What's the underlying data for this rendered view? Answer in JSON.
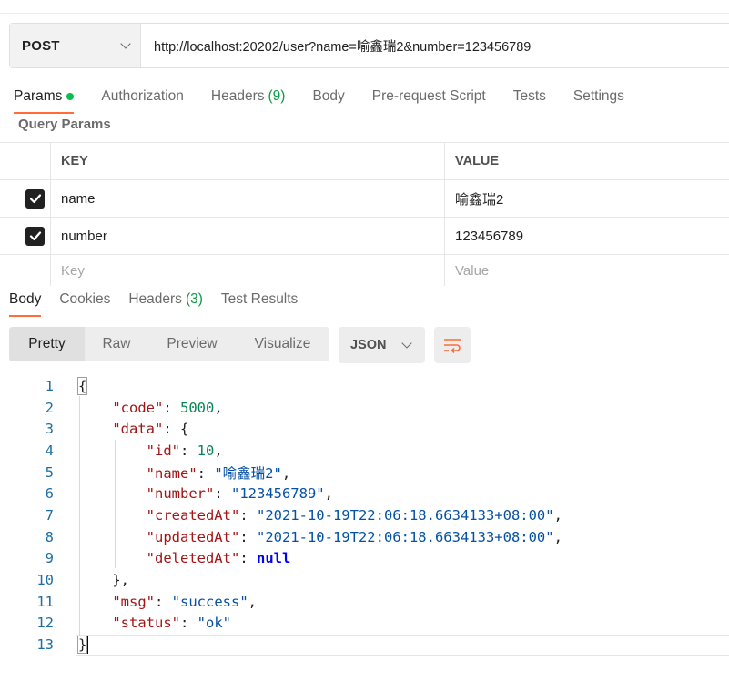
{
  "request": {
    "method": "POST",
    "url": "http://localhost:20202/user?name=喻鑫瑞2&number=123456789"
  },
  "request_tabs": [
    {
      "label": "Params",
      "active": true,
      "dot": true
    },
    {
      "label": "Authorization"
    },
    {
      "label": "Headers",
      "count": "(9)"
    },
    {
      "label": "Body"
    },
    {
      "label": "Pre-request Script"
    },
    {
      "label": "Tests"
    },
    {
      "label": "Settings"
    }
  ],
  "query_params": {
    "title": "Query Params",
    "headers": {
      "key": "KEY",
      "value": "VALUE"
    },
    "rows": [
      {
        "checked": true,
        "key": "name",
        "value": "喻鑫瑞2"
      },
      {
        "checked": true,
        "key": "number",
        "value": "123456789"
      }
    ],
    "placeholder": {
      "key": "Key",
      "value": "Value"
    }
  },
  "response_tabs": [
    {
      "label": "Body",
      "active": true
    },
    {
      "label": "Cookies"
    },
    {
      "label": "Headers",
      "count": "(3)"
    },
    {
      "label": "Test Results"
    }
  ],
  "view_modes": [
    "Pretty",
    "Raw",
    "Preview",
    "Visualize"
  ],
  "active_view": "Pretty",
  "format": "JSON",
  "icons": {
    "method_dropdown": "chevron-down-icon",
    "format_dropdown": "chevron-down-icon",
    "wrap": "wrap-lines-icon",
    "check": "checkmark-icon"
  },
  "colors": {
    "accent": "#ff6c37",
    "green": "#0cbb52",
    "line_number": "#1c6ea4",
    "json_key": "#a31515",
    "json_string": "#0451a5",
    "json_number": "#098658",
    "json_null": "#0000ff"
  },
  "response_lines": [
    {
      "n": "1",
      "indent": 0,
      "parts": [
        [
          "p",
          "{"
        ]
      ]
    },
    {
      "n": "2",
      "indent": 1,
      "parts": [
        [
          "k",
          "\"code\""
        ],
        [
          "p",
          ": "
        ],
        [
          "n",
          "5000"
        ],
        [
          "p",
          ","
        ]
      ]
    },
    {
      "n": "3",
      "indent": 1,
      "parts": [
        [
          "k",
          "\"data\""
        ],
        [
          "p",
          ": {"
        ]
      ]
    },
    {
      "n": "4",
      "indent": 2,
      "parts": [
        [
          "k",
          "\"id\""
        ],
        [
          "p",
          ": "
        ],
        [
          "n",
          "10"
        ],
        [
          "p",
          ","
        ]
      ]
    },
    {
      "n": "5",
      "indent": 2,
      "parts": [
        [
          "k",
          "\"name\""
        ],
        [
          "p",
          ": "
        ],
        [
          "s",
          "\"喻鑫瑞2\""
        ],
        [
          "p",
          ","
        ]
      ]
    },
    {
      "n": "6",
      "indent": 2,
      "parts": [
        [
          "k",
          "\"number\""
        ],
        [
          "p",
          ": "
        ],
        [
          "s",
          "\"123456789\""
        ],
        [
          "p",
          ","
        ]
      ]
    },
    {
      "n": "7",
      "indent": 2,
      "parts": [
        [
          "k",
          "\"createdAt\""
        ],
        [
          "p",
          ": "
        ],
        [
          "s",
          "\"2021-10-19T22:06:18.6634133+08:00\""
        ],
        [
          "p",
          ","
        ]
      ]
    },
    {
      "n": "8",
      "indent": 2,
      "parts": [
        [
          "k",
          "\"updatedAt\""
        ],
        [
          "p",
          ": "
        ],
        [
          "s",
          "\"2021-10-19T22:06:18.6634133+08:00\""
        ],
        [
          "p",
          ","
        ]
      ]
    },
    {
      "n": "9",
      "indent": 2,
      "parts": [
        [
          "k",
          "\"deletedAt\""
        ],
        [
          "p",
          ": "
        ],
        [
          "nl",
          "null"
        ]
      ]
    },
    {
      "n": "10",
      "indent": 1,
      "parts": [
        [
          "p",
          "},"
        ]
      ]
    },
    {
      "n": "11",
      "indent": 1,
      "parts": [
        [
          "k",
          "\"msg\""
        ],
        [
          "p",
          ": "
        ],
        [
          "s",
          "\"success\""
        ],
        [
          "p",
          ","
        ]
      ]
    },
    {
      "n": "12",
      "indent": 1,
      "parts": [
        [
          "k",
          "\"status\""
        ],
        [
          "p",
          ": "
        ],
        [
          "s",
          "\"ok\""
        ]
      ]
    },
    {
      "n": "13",
      "indent": 0,
      "parts": [
        [
          "p",
          "}"
        ]
      ]
    }
  ]
}
